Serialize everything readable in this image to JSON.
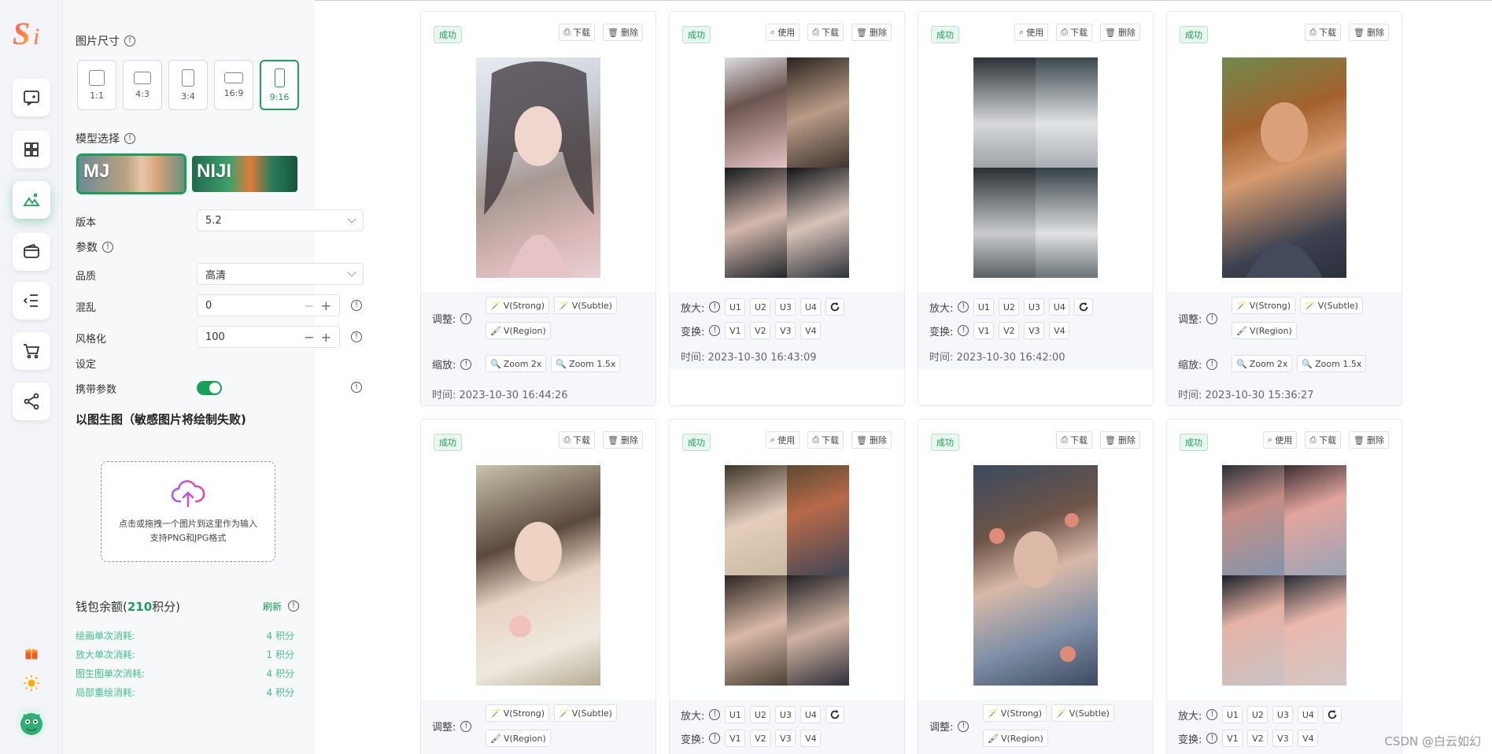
{
  "panel": {
    "size_title": "图片尺寸",
    "sizes": [
      {
        "label": "1:1"
      },
      {
        "label": "4:3"
      },
      {
        "label": "3:4"
      },
      {
        "label": "16:9"
      },
      {
        "label": "9:16"
      }
    ],
    "model_title": "模型选择",
    "models": [
      {
        "label": "MJ"
      },
      {
        "label": "NIJI"
      }
    ],
    "version_label": "版本",
    "version_value": "5.2",
    "params_label": "参数",
    "quality_label": "品质",
    "quality_value": "高清",
    "chaos_label": "混乱",
    "chaos_value": "0",
    "stylize_label": "风格化",
    "stylize_value": "100",
    "settings_label": "设定",
    "carry_label": "携带参数",
    "img2img_title": "以图生图（敏感图片将绘制失败)",
    "upload_line1": "点击或拖拽一个图片到这里作为输入",
    "upload_line2": "支持PNG和JPG格式",
    "wallet_prefix": "钱包余额(",
    "wallet_points": "210",
    "wallet_suffix": "积分)",
    "refresh": "刷新",
    "costs": [
      {
        "label": "绘画单次消耗:",
        "value": "4 积分"
      },
      {
        "label": "放大单次消耗:",
        "value": "1 积分"
      },
      {
        "label": "图生图单次消耗:",
        "value": "4 积分"
      },
      {
        "label": "局部重绘消耗:",
        "value": "4 积分"
      }
    ]
  },
  "labels": {
    "success": "成功",
    "use": "使用",
    "download": "下载",
    "delete": "删除",
    "adjust": "调整:",
    "zoom": "缩放:",
    "upscale": "放大:",
    "variation": "变换:",
    "v_strong": "V(Strong)",
    "v_subtle": "V(Subtle)",
    "v_region": "V(Region)",
    "zoom2": "Zoom 2x",
    "zoom15": "Zoom 1.5x",
    "u": [
      "U1",
      "U2",
      "U3",
      "U4"
    ],
    "v": [
      "V1",
      "V2",
      "V3",
      "V4"
    ]
  },
  "cards": [
    {
      "time": "时间:  2023-10-30 16:44:26"
    },
    {
      "time": "时间:  2023-10-30 16:43:09"
    },
    {
      "time": "时间:  2023-10-30 16:42:00"
    },
    {
      "time": "时间:  2023-10-30 15:36:27"
    }
  ],
  "watermark": "CSDN @白云如幻",
  "colors": {
    "accent": "#18a058",
    "cost": "#3cc38b"
  }
}
